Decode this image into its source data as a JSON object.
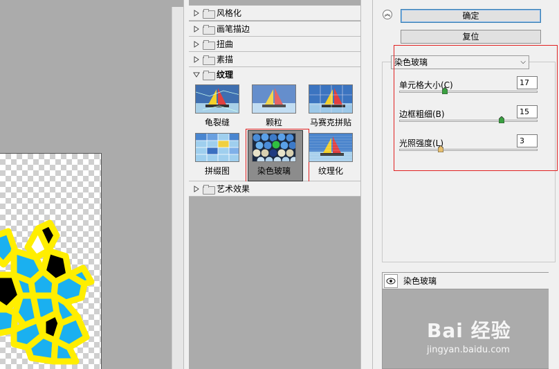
{
  "gallery": {
    "categories": [
      {
        "label": "风格化",
        "state": "collapsed"
      },
      {
        "label": "画笔描边",
        "state": "collapsed"
      },
      {
        "label": "扭曲",
        "state": "collapsed"
      },
      {
        "label": "素描",
        "state": "collapsed"
      },
      {
        "label": "纹理",
        "state": "expanded"
      },
      {
        "label": "艺术效果",
        "state": "collapsed"
      }
    ],
    "thumbnails": [
      {
        "label": "龟裂缝"
      },
      {
        "label": "颗粒"
      },
      {
        "label": "马赛克拼贴"
      },
      {
        "label": "拼缀图"
      },
      {
        "label": "染色玻璃",
        "selected": true
      },
      {
        "label": "纹理化"
      }
    ]
  },
  "panel": {
    "ok_label": "确定",
    "reset_label": "复位",
    "filter_select": "染色玻璃",
    "params": [
      {
        "label": "单元格大小(C)",
        "value": "17",
        "slider_fraction": 0.33
      },
      {
        "label": "边框粗细(B)",
        "value": "15",
        "slider_fraction": 0.74
      },
      {
        "label": "光照强度(L)",
        "value": "3",
        "slider_fraction": 0.3
      }
    ],
    "layer_name": "染色玻璃"
  },
  "watermark": {
    "title": "Bai 经验",
    "url": "jingyan.baidu.com"
  },
  "colors": {
    "highlight": "#e02020",
    "panel_bg": "#f0f0f0",
    "workspace_bg": "#ababab",
    "glass_yellow": "#ffee00",
    "glass_blue": "#1ab0f0"
  }
}
